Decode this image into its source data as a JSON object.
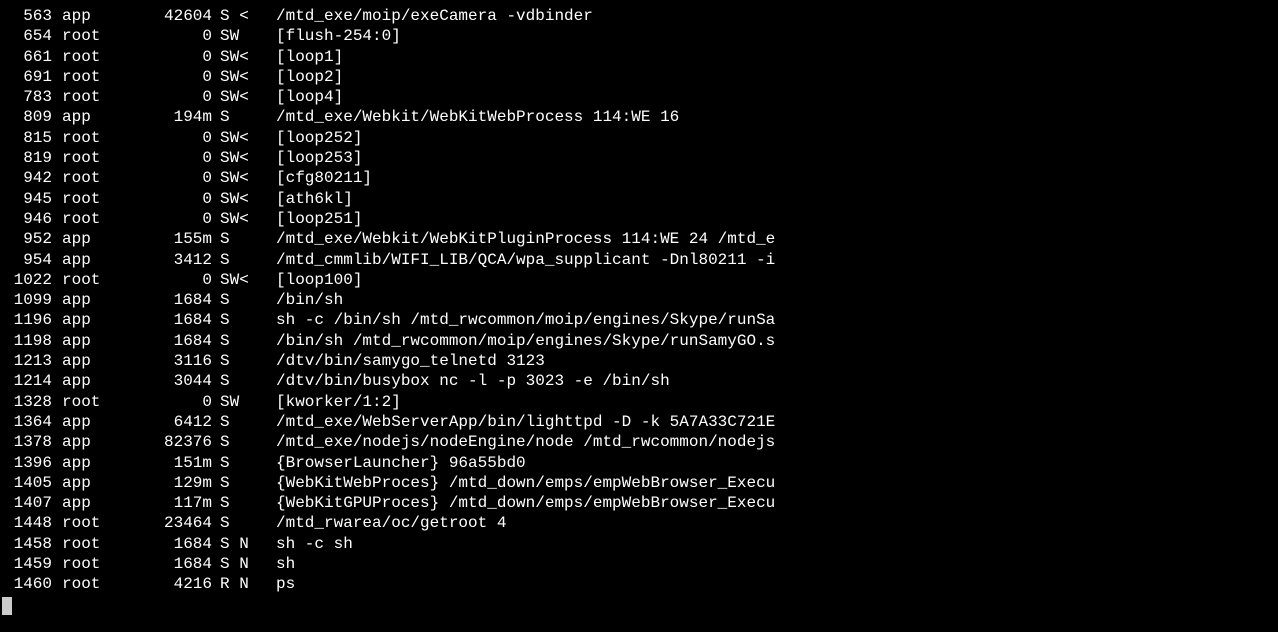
{
  "processes": [
    {
      "pid": "563",
      "user": "app",
      "vsz": "42604",
      "stat": "S <",
      "cmd": "/mtd_exe/moip/exeCamera -vdbinder"
    },
    {
      "pid": "654",
      "user": "root",
      "vsz": "0",
      "stat": "SW",
      "cmd": "[flush-254:0]"
    },
    {
      "pid": "661",
      "user": "root",
      "vsz": "0",
      "stat": "SW<",
      "cmd": "[loop1]"
    },
    {
      "pid": "691",
      "user": "root",
      "vsz": "0",
      "stat": "SW<",
      "cmd": "[loop2]"
    },
    {
      "pid": "783",
      "user": "root",
      "vsz": "0",
      "stat": "SW<",
      "cmd": "[loop4]"
    },
    {
      "pid": "809",
      "user": "app",
      "vsz": "194m",
      "stat": "S",
      "cmd": "/mtd_exe/Webkit/WebKitWebProcess 114:WE 16"
    },
    {
      "pid": "815",
      "user": "root",
      "vsz": "0",
      "stat": "SW<",
      "cmd": "[loop252]"
    },
    {
      "pid": "819",
      "user": "root",
      "vsz": "0",
      "stat": "SW<",
      "cmd": "[loop253]"
    },
    {
      "pid": "942",
      "user": "root",
      "vsz": "0",
      "stat": "SW<",
      "cmd": "[cfg80211]"
    },
    {
      "pid": "945",
      "user": "root",
      "vsz": "0",
      "stat": "SW<",
      "cmd": "[ath6kl]"
    },
    {
      "pid": "946",
      "user": "root",
      "vsz": "0",
      "stat": "SW<",
      "cmd": "[loop251]"
    },
    {
      "pid": "952",
      "user": "app",
      "vsz": "155m",
      "stat": "S",
      "cmd": "/mtd_exe/Webkit/WebKitPluginProcess 114:WE 24 /mtd_e"
    },
    {
      "pid": "954",
      "user": "app",
      "vsz": "3412",
      "stat": "S",
      "cmd": "/mtd_cmmlib/WIFI_LIB/QCA/wpa_supplicant -Dnl80211 -i"
    },
    {
      "pid": "1022",
      "user": "root",
      "vsz": "0",
      "stat": "SW<",
      "cmd": "[loop100]"
    },
    {
      "pid": "1099",
      "user": "app",
      "vsz": "1684",
      "stat": "S",
      "cmd": "/bin/sh"
    },
    {
      "pid": "1196",
      "user": "app",
      "vsz": "1684",
      "stat": "S",
      "cmd": "sh -c /bin/sh /mtd_rwcommon/moip/engines/Skype/runSa"
    },
    {
      "pid": "1198",
      "user": "app",
      "vsz": "1684",
      "stat": "S",
      "cmd": "/bin/sh /mtd_rwcommon/moip/engines/Skype/runSamyGO.s"
    },
    {
      "pid": "1213",
      "user": "app",
      "vsz": "3116",
      "stat": "S",
      "cmd": "/dtv/bin/samygo_telnetd 3123"
    },
    {
      "pid": "1214",
      "user": "app",
      "vsz": "3044",
      "stat": "S",
      "cmd": "/dtv/bin/busybox nc -l -p 3023 -e /bin/sh"
    },
    {
      "pid": "1328",
      "user": "root",
      "vsz": "0",
      "stat": "SW",
      "cmd": "[kworker/1:2]"
    },
    {
      "pid": "1364",
      "user": "app",
      "vsz": "6412",
      "stat": "S",
      "cmd": "/mtd_exe/WebServerApp/bin/lighttpd -D -k 5A7A33C721E"
    },
    {
      "pid": "1378",
      "user": "app",
      "vsz": "82376",
      "stat": "S",
      "cmd": "/mtd_exe/nodejs/nodeEngine/node /mtd_rwcommon/nodejs"
    },
    {
      "pid": "1396",
      "user": "app",
      "vsz": "151m",
      "stat": "S",
      "cmd": "{BrowserLauncher} 96a55bd0"
    },
    {
      "pid": "1405",
      "user": "app",
      "vsz": "129m",
      "stat": "S",
      "cmd": "{WebKitWebProces} /mtd_down/emps/empWebBrowser_Execu"
    },
    {
      "pid": "1407",
      "user": "app",
      "vsz": "117m",
      "stat": "S",
      "cmd": "{WebKitGPUProces} /mtd_down/emps/empWebBrowser_Execu"
    },
    {
      "pid": "1448",
      "user": "root",
      "vsz": "23464",
      "stat": "S",
      "cmd": "/mtd_rwarea/oc/getroot 4"
    },
    {
      "pid": "1458",
      "user": "root",
      "vsz": "1684",
      "stat": "S N",
      "cmd": "sh -c sh"
    },
    {
      "pid": "1459",
      "user": "root",
      "vsz": "1684",
      "stat": "S N",
      "cmd": "sh"
    },
    {
      "pid": "1460",
      "user": "root",
      "vsz": "4216",
      "stat": "R N",
      "cmd": "ps"
    }
  ]
}
